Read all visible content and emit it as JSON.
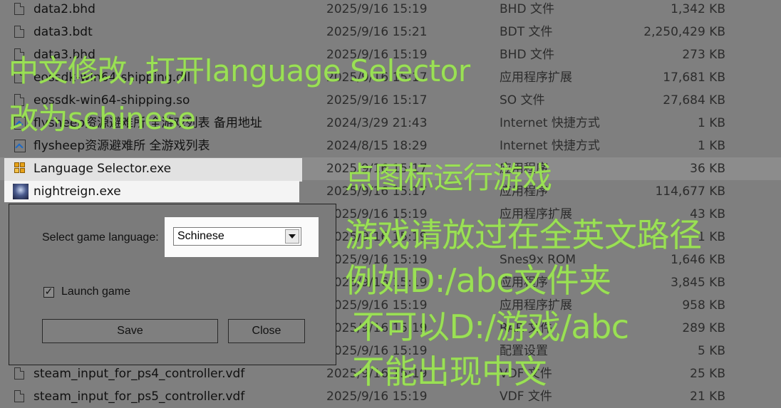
{
  "files": [
    {
      "name": "data2.bhd",
      "date": "2025/9/16 15:19",
      "type": "BHD 文件",
      "size": "1,342 KB"
    },
    {
      "name": "data3.bdt",
      "date": "2025/9/16 15:21",
      "type": "BDT 文件",
      "size": "2,250,429 KB"
    },
    {
      "name": "data3.bhd",
      "date": "2025/9/16 15:19",
      "type": "BHD 文件",
      "size": "273 KB"
    },
    {
      "name": "eossdk-win64-shipping.dll",
      "date": "2025/9/16 15:17",
      "type": "应用程序扩展",
      "size": "17,681 KB"
    },
    {
      "name": "eossdk-win64-shipping.so",
      "date": "2025/9/16 15:17",
      "type": "SO 文件",
      "size": "27,684 KB"
    },
    {
      "name": "flysheep资源避难所 全游戏列表 备用地址",
      "date": "2024/3/29 21:43",
      "type": "Internet 快捷方式",
      "size": "1 KB"
    },
    {
      "name": "flysheep资源避难所 全游戏列表",
      "date": "2024/8/15 18:29",
      "type": "Internet 快捷方式",
      "size": "1 KB"
    },
    {
      "name": "Language Selector.exe",
      "date": "2025/9/16 15:17",
      "type": "应用程序",
      "size": "36 KB"
    },
    {
      "name": "nightreign.exe",
      "date": "2025/9/16 15:17",
      "type": "应用程序",
      "size": "114,677 KB"
    },
    {
      "name": "",
      "date": "2025/9/16 15:19",
      "type": "应用程序扩展",
      "size": "43 KB"
    },
    {
      "name": "",
      "date": "2025/9/16 15:19",
      "type": "",
      "size": "1 KB"
    },
    {
      "name": "",
      "date": "2025/9/16 15:19",
      "type": "Snes9x ROM",
      "size": "1,646 KB"
    },
    {
      "name": "",
      "date": "2025/9/16 15:19",
      "type": "应用程序",
      "size": "3,845 KB"
    },
    {
      "name": "",
      "date": "2025/9/16 15:19",
      "type": "应用程序扩展",
      "size": "958 KB"
    },
    {
      "name": "",
      "date": "2025/9/16 15:19",
      "type": "RAR 文件",
      "size": "289 KB"
    },
    {
      "name": "",
      "date": "2025/9/16 15:19",
      "type": "配置设置",
      "size": "5 KB"
    },
    {
      "name": "steam_input_for_ps4_controller.vdf",
      "date": "2025/9/16 15:19",
      "type": "VDF 文件",
      "size": "25 KB"
    },
    {
      "name": "steam_input_for_ps5_controller.vdf",
      "date": "2025/9/16 15:19",
      "type": "VDF 文件",
      "size": "21 KB"
    }
  ],
  "dialog": {
    "label": "Select game language:",
    "selected": "Schinese",
    "launch_label": "Launch game",
    "launch_checked": "✓",
    "save": "Save",
    "close": "Close"
  },
  "annotations": [
    "中文修改, 打开language Selector",
    "改为schinese",
    "点图标运行游戏",
    "游戏请放过在全英文路径",
    "例如D:/abc文件夹",
    "不可以D:/游戏/abc",
    "不能出现中文"
  ]
}
